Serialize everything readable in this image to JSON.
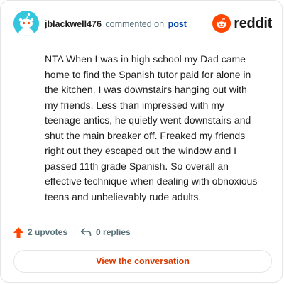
{
  "header": {
    "username": "jblackwell476",
    "action_text": "commented on",
    "post_link": "post",
    "brand_name": "reddit"
  },
  "comment": {
    "body": "NTA When I was in high school my Dad came home to find the Spanish tutor paid for alone in the kitchen. I was downstairs hanging out with my friends. Less than impressed with my teenage antics, he quietly went downstairs and shut the main breaker off. Freaked my friends right out they escaped out the window and I passed 11th grade Spanish. So overall an effective technique when dealing with obnoxious teens and unbelievably rude adults."
  },
  "actions": {
    "upvotes_label": "2 upvotes",
    "replies_label": "0 replies"
  },
  "cta": {
    "label": "View the conversation"
  },
  "icons": {
    "avatar": "snoo-avatar-icon",
    "brand": "reddit-logo-icon",
    "upvote": "upvote-arrow-icon",
    "reply": "reply-arrow-icon"
  },
  "colors": {
    "brand_orange": "#ff4500",
    "avatar_bg": "#34c6dc",
    "link_blue": "#0045ac",
    "muted_text": "#576f76",
    "cta_text": "#d93a00",
    "border": "#e3e6e8"
  }
}
